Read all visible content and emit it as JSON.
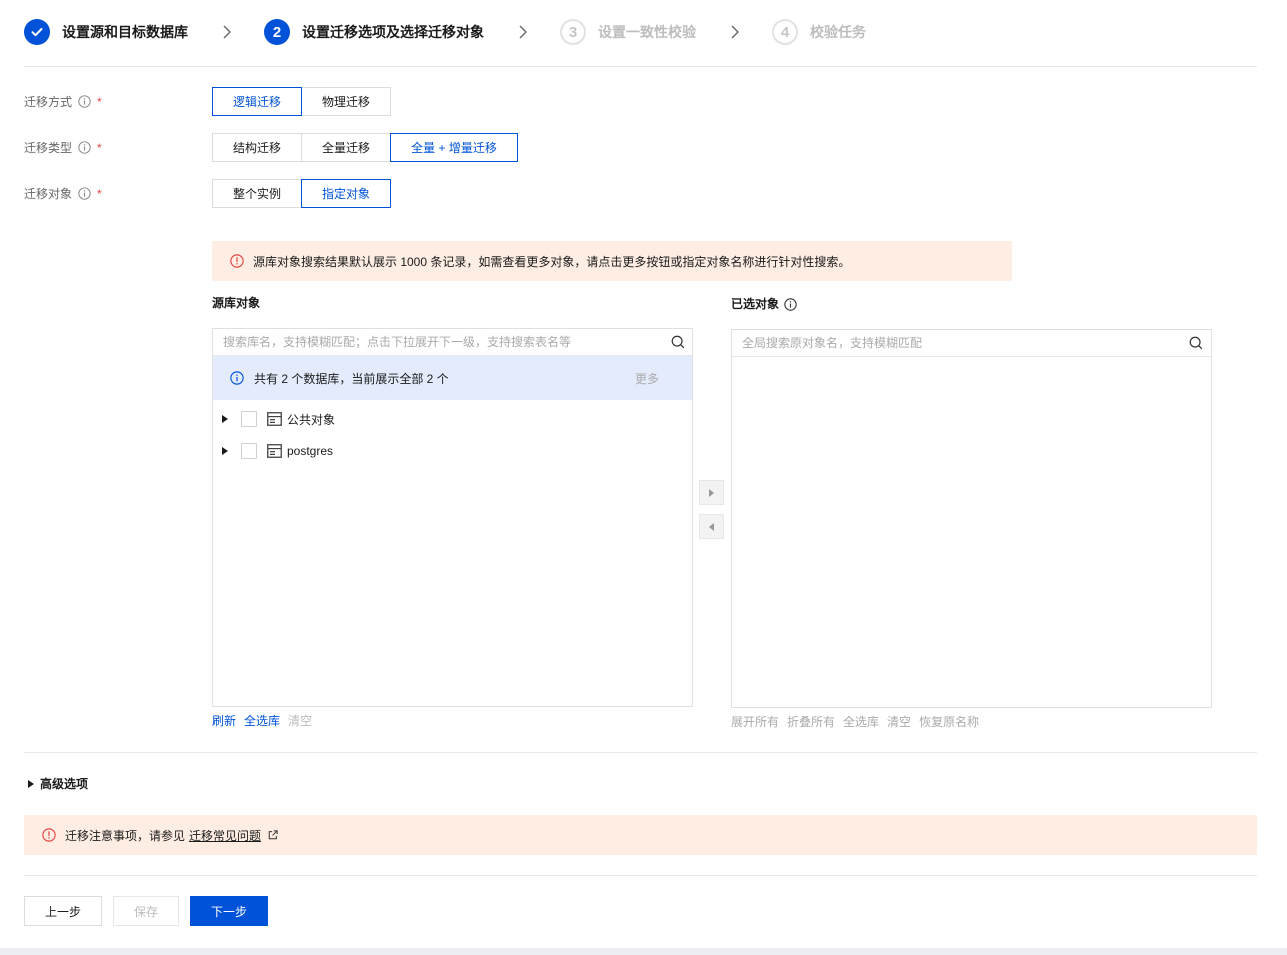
{
  "steps": [
    {
      "icon": "check-icon",
      "label": "设置源和目标数据库"
    },
    {
      "number": "2",
      "label": "设置迁移选项及选择迁移对象"
    },
    {
      "number": "3",
      "label": "设置一致性校验"
    },
    {
      "number": "4",
      "label": "校验任务"
    }
  ],
  "current_step": 2,
  "form": {
    "required_mark": "*",
    "migration_method": {
      "label": "迁移方式",
      "options": [
        "逻辑迁移",
        "物理迁移"
      ],
      "selected": 0
    },
    "migration_type": {
      "label": "迁移类型",
      "options": [
        "结构迁移",
        "全量迁移",
        "全量 + 增量迁移"
      ],
      "selected": 2
    },
    "migration_object": {
      "label": "迁移对象",
      "options": [
        "整个实例",
        "指定对象"
      ],
      "selected": 1
    }
  },
  "object_notice": "源库对象搜索结果默认展示 1000 条记录，如需查看更多对象，请点击更多按钮或指定对象名称进行针对性搜索。",
  "source_panel": {
    "title": "源库对象",
    "search_placeholder": "搜索库名，支持模糊匹配；点击下拉展开下一级，支持搜索表名等",
    "info": "共有 2 个数据库，当前展示全部 2 个",
    "more_label": "更多",
    "tree": [
      {
        "label": "公共对象",
        "icon": "database-icon",
        "checked": false,
        "expanded": false
      },
      {
        "label": "postgres",
        "icon": "database-icon",
        "checked": false,
        "expanded": false
      }
    ],
    "actions": {
      "refresh": "刷新",
      "select_all": "全选库",
      "clear": "清空"
    }
  },
  "transfer": {
    "add_icon": "caret-right-icon",
    "remove_icon": "caret-left-icon"
  },
  "target_panel": {
    "title": "已选对象",
    "search_placeholder": "全局搜索原对象名，支持模糊匹配",
    "items": [],
    "actions": {
      "expand_all": "展开所有",
      "collapse_all": "折叠所有",
      "select_all": "全选库",
      "clear": "清空",
      "restore_names": "恢复原名称"
    }
  },
  "advanced": {
    "label": "高级选项",
    "expanded": false
  },
  "footer_notice": {
    "text": "迁移注意事项，请参见",
    "link": "迁移常见问题"
  },
  "buttons": {
    "prev": "上一步",
    "save": "保存",
    "next": "下一步",
    "save_disabled": true
  },
  "colors": {
    "primary": "#0052d9",
    "required": "#e54545",
    "warning_bg": "#fdede3",
    "warning_icon": "#e54545",
    "info_bg": "#e3ebfc",
    "disabled": "#bbbbbb"
  }
}
